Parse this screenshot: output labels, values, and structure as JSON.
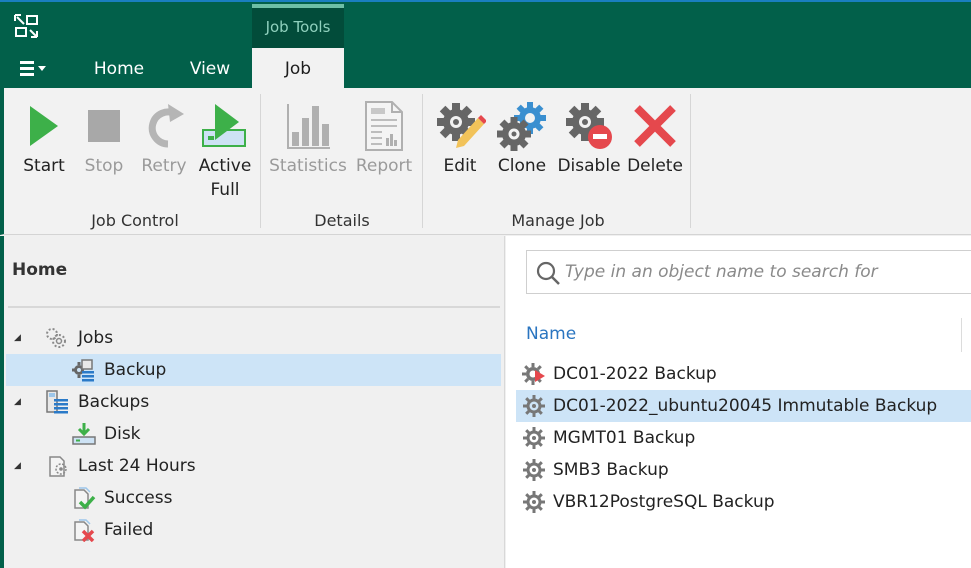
{
  "colors": {
    "brand_green": "#02604a",
    "context_tab_bg": "#024c3a",
    "selection": "#cde4f7",
    "link_blue": "#2a75c0",
    "start_green": "#3db049",
    "delete_red": "#e5484d",
    "clone_blue": "#3a8fd0"
  },
  "titlebar": {
    "logo_icon": "veeam-logo-icon",
    "context_group_label": "Job Tools"
  },
  "ribbon_tabs": [
    {
      "label": "Home",
      "active": false
    },
    {
      "label": "View",
      "active": false
    },
    {
      "label": "Job",
      "active": true
    }
  ],
  "main_menu_icon": "hamburger-menu-icon",
  "ribbon": {
    "groups": [
      {
        "label": "Job Control",
        "buttons": [
          {
            "label": "Start",
            "icon": "play-icon",
            "enabled": true
          },
          {
            "label": "Stop",
            "icon": "stop-icon",
            "enabled": false
          },
          {
            "label": "Retry",
            "icon": "retry-icon",
            "enabled": false
          },
          {
            "label_line1": "Active",
            "label_line2": "Full",
            "icon": "active-full-icon",
            "enabled": true
          }
        ]
      },
      {
        "label": "Details",
        "buttons": [
          {
            "label": "Statistics",
            "icon": "statistics-icon",
            "enabled": false
          },
          {
            "label": "Report",
            "icon": "report-icon",
            "enabled": false
          }
        ]
      },
      {
        "label": "Manage Job",
        "buttons": [
          {
            "label": "Edit",
            "icon": "edit-gear-icon",
            "enabled": true
          },
          {
            "label": "Clone",
            "icon": "clone-gear-icon",
            "enabled": true
          },
          {
            "label": "Disable",
            "icon": "disable-gear-icon",
            "enabled": true
          },
          {
            "label": "Delete",
            "icon": "delete-x-icon",
            "enabled": true
          }
        ]
      }
    ]
  },
  "nav": {
    "title": "Home",
    "tree": [
      {
        "label": "Jobs",
        "icon": "jobs-gears-icon",
        "level": 0,
        "expanded": true
      },
      {
        "label": "Backup",
        "icon": "backup-job-icon",
        "level": 1,
        "selected": true
      },
      {
        "label": "Backups",
        "icon": "backups-icon",
        "level": 0,
        "expanded": true
      },
      {
        "label": "Disk",
        "icon": "disk-icon",
        "level": 1
      },
      {
        "label": "Last 24 Hours",
        "icon": "last-24-hours-icon",
        "level": 0,
        "expanded": true
      },
      {
        "label": "Success",
        "icon": "success-icon",
        "level": 1
      },
      {
        "label": "Failed",
        "icon": "failed-icon",
        "level": 1
      }
    ]
  },
  "content": {
    "search_placeholder": "Type in an object name to search for",
    "search_value": "",
    "column_header": "Name",
    "jobs": [
      {
        "name": "DC01-2022 Backup",
        "icon": "job-running-icon",
        "selected": false
      },
      {
        "name": "DC01-2022_ubuntu20045 Immutable Backup",
        "icon": "job-gear-icon",
        "selected": true
      },
      {
        "name": "MGMT01 Backup",
        "icon": "job-gear-icon",
        "selected": false
      },
      {
        "name": "SMB3 Backup",
        "icon": "job-gear-icon",
        "selected": false
      },
      {
        "name": "VBR12PostgreSQL Backup",
        "icon": "job-gear-icon",
        "selected": false
      }
    ]
  }
}
